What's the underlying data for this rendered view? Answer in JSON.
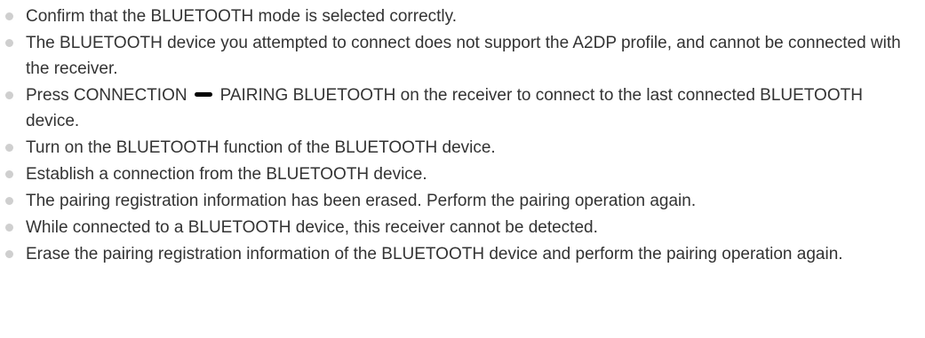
{
  "items": [
    {
      "text": "Confirm that the BLUETOOTH mode is selected correctly."
    },
    {
      "text": "The BLUETOOTH device you attempted to connect does not support the A2DP profile, and cannot be connected with the receiver."
    },
    {
      "text_before": "Press CONNECTION",
      "text_after": "PAIRING BLUETOOTH on the receiver to connect to the last connected BLUETOOTH device.",
      "icon": "dash-icon"
    },
    {
      "text": "Turn on the BLUETOOTH function of the BLUETOOTH device."
    },
    {
      "text": "Establish a connection from the BLUETOOTH device."
    },
    {
      "text": "The pairing registration information has been erased. Perform the pairing operation again."
    },
    {
      "text": "While connected to a BLUETOOTH device, this receiver cannot be detected."
    },
    {
      "text": "Erase the pairing registration information of the BLUETOOTH device and perform the pairing operation again."
    }
  ]
}
